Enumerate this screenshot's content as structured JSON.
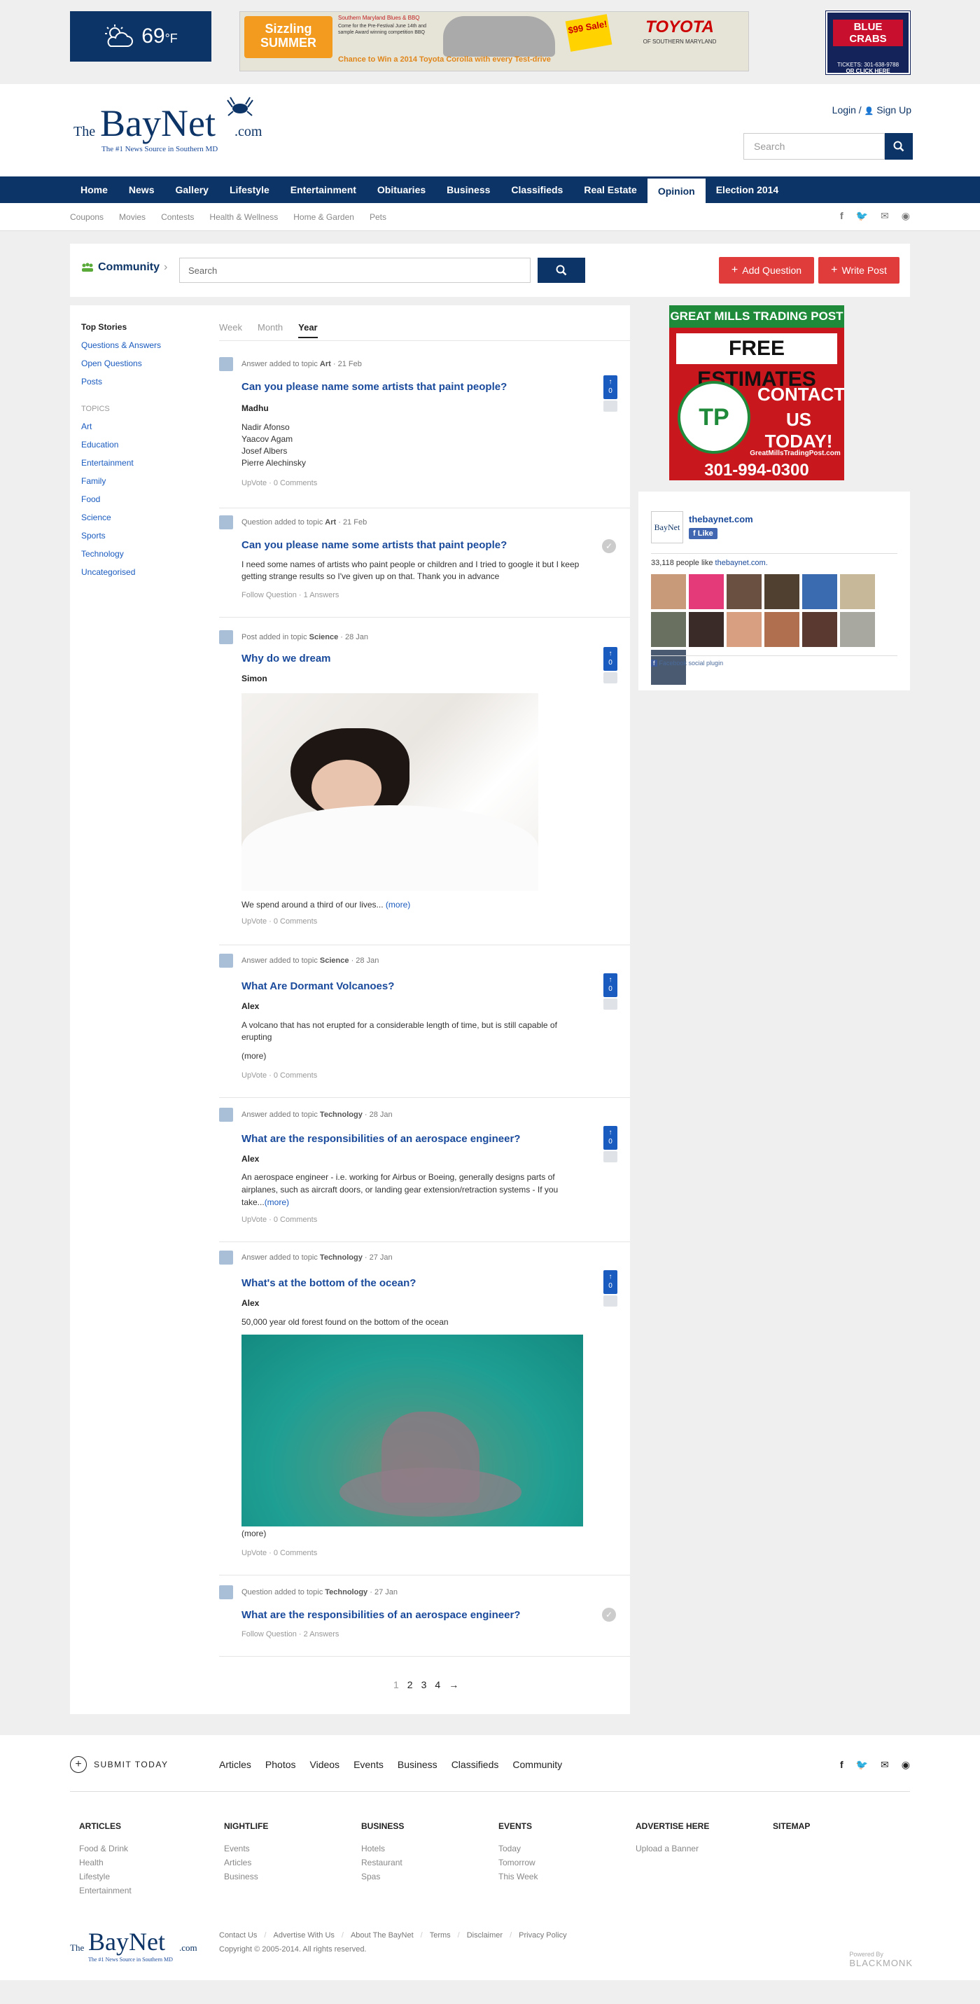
{
  "weather": {
    "temp": "69",
    "unit": "°F"
  },
  "ads": {
    "top_banner": {
      "headline": "Sizzling SUMMER",
      "sub1": "Southern Maryland Blues & BBQ",
      "sub2": "Come for the Pre-Festival June 14th and sample Award winning competition BBQ",
      "tagline": "Chance to Win a 2014 Toyota Corolla with every Test-drive",
      "price": "$99 Sale!",
      "brand": "TOYOTA",
      "brand_sub": "OF SOUTHERN MARYLAND"
    },
    "blue_crabs": {
      "title": "BLUE CRABS",
      "tickets": "TICKETS: 301-638-9788",
      "cta": "OR CLICK HERE"
    },
    "side_ad": {
      "title": "GREAT MILLS TRADING POST",
      "free": "FREE ESTIMATES",
      "contact1": "CONTACT",
      "contact2": "US TODAY!",
      "logo": "TP",
      "url": "GreatMillsTradingPost.com",
      "phone": "301-994-0300"
    }
  },
  "header": {
    "logo_the": "The",
    "logo_name": "BayNet",
    "logo_com": ".com",
    "logo_tagline": "The #1 News Source in Southern MD",
    "login": "Login",
    "signup": "Sign Up",
    "search_placeholder": "Search"
  },
  "nav": [
    "Home",
    "News",
    "Gallery",
    "Lifestyle",
    "Entertainment",
    "Obituaries",
    "Business",
    "Classifieds",
    "Real Estate",
    "Opinion",
    "Election 2014"
  ],
  "nav_active": "Opinion",
  "subnav": [
    "Coupons",
    "Movies",
    "Contests",
    "Health & Wellness",
    "Home & Garden",
    "Pets"
  ],
  "community": {
    "title": "Community",
    "search_placeholder": "Search",
    "add_question": "Add Question",
    "write_post": "Write Post"
  },
  "sidebar": {
    "top_heading": "Top Stories",
    "top_links": [
      "Questions & Answers",
      "Open Questions",
      "Posts"
    ],
    "topics_heading": "TOPICS",
    "topics": [
      "Art",
      "Education",
      "Entertainment",
      "Family",
      "Food",
      "Science",
      "Sports",
      "Technology",
      "Uncategorised"
    ]
  },
  "tabs": [
    "Week",
    "Month",
    "Year"
  ],
  "tab_active": "Year",
  "feed": [
    {
      "meta_prefix": "Answer added to topic",
      "topic": "Art",
      "date": "21 Feb",
      "title": "Can you please name some artists that paint people?",
      "author": "Madhu",
      "lines": [
        "Nadir Afonso",
        "Yaacov Agam",
        "Josef Albers",
        "Pierre Alechinsky"
      ],
      "action1": "UpVote",
      "action2": "0 Comments",
      "votes": "0"
    },
    {
      "meta_prefix": "Question added to topic",
      "topic": "Art",
      "date": "21 Feb",
      "title": "Can you please name some artists that paint people?",
      "body": "I need some names of artists who paint people or children and I tried to google it but I keep getting strange results so I've given up on that. Thank you in advance",
      "action1": "Follow Question",
      "action2": "1 Answers"
    },
    {
      "meta_prefix": "Post added in topic",
      "topic": "Science",
      "date": "28 Jan",
      "title": "Why do we dream",
      "author": "Simon",
      "body": "We spend around a third of our lives...",
      "more": "(more)",
      "action1": "UpVote",
      "action2": "0 Comments",
      "votes": "0"
    },
    {
      "meta_prefix": "Answer added to topic",
      "topic": "Science",
      "date": "28 Jan",
      "title": "What Are Dormant Volcanoes?",
      "author": "Alex",
      "body": "A volcano that has not erupted for a considerable length of time, but is still capable of erupting",
      "more": "(more)",
      "action1": "UpVote",
      "action2": "0 Comments",
      "votes": "0"
    },
    {
      "meta_prefix": "Answer added to topic",
      "topic": "Technology",
      "date": "28 Jan",
      "title": "What are the responsibilities of an aerospace engineer?",
      "author": "Alex",
      "body": "An aerospace engineer - i.e. working for Airbus or Boeing, generally designs parts of airplanes, such as aircraft doors, or landing gear extension/retraction systems - If you take...",
      "more": "(more)",
      "action1": "UpVote",
      "action2": "0 Comments",
      "votes": "0"
    },
    {
      "meta_prefix": "Answer added to topic",
      "topic": "Technology",
      "date": "27 Jan",
      "title": "What's at the bottom of the ocean?",
      "author": "Alex",
      "body": "50,000 year old forest found on the bottom of the ocean",
      "more": "(more)",
      "action1": "UpVote",
      "action2": "0 Comments",
      "votes": "0"
    },
    {
      "meta_prefix": "Question added to topic",
      "topic": "Technology",
      "date": "27 Jan",
      "title": "What are the responsibilities of an aerospace engineer?",
      "action1": "Follow Question",
      "action2": "2 Answers"
    }
  ],
  "pagination": [
    "1",
    "2",
    "3",
    "4",
    "→"
  ],
  "facebook": {
    "page": "thebaynet.com",
    "like": "Like",
    "likes_text": "33,118 people like",
    "likes_link": "thebaynet.com.",
    "plugin": "Facebook social plugin"
  },
  "footer": {
    "submit": "SUBMIT TODAY",
    "links": [
      "Articles",
      "Photos",
      "Videos",
      "Events",
      "Business",
      "Classifieds",
      "Community"
    ],
    "cols": [
      {
        "h": "ARTICLES",
        "items": [
          "Food & Drink",
          "Health",
          "Lifestyle",
          "Entertainment"
        ]
      },
      {
        "h": "NIGHTLIFE",
        "items": [
          "Events",
          "Articles",
          "Business"
        ]
      },
      {
        "h": "BUSINESS",
        "items": [
          "Hotels",
          "Restaurant",
          "Spas"
        ]
      },
      {
        "h": "EVENTS",
        "items": [
          "Today",
          "Tomorrow",
          "This Week"
        ]
      },
      {
        "h": "ADVERTISE HERE",
        "items": [
          "Upload a Banner"
        ]
      },
      {
        "h": "SITEMAP",
        "items": []
      }
    ],
    "bottom_links": [
      "Contact Us",
      "Advertise With Us",
      "About The BayNet",
      "Terms",
      "Disclaimer",
      "Privacy Policy"
    ],
    "copyright": "Copyright © 2005-2014. All rights reserved.",
    "powered": "Powered By",
    "powered_brand": "BLACKMONK"
  }
}
